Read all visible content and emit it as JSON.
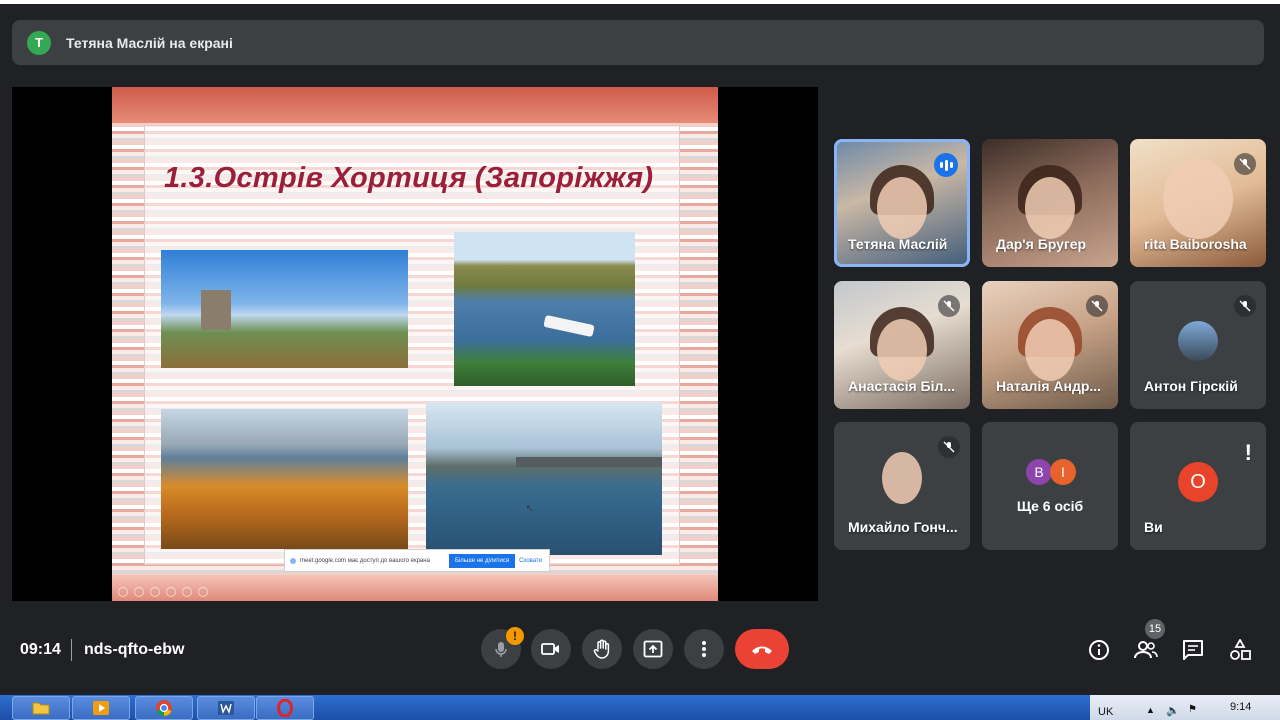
{
  "banner": {
    "avatar_letter": "T",
    "text": "Тетяна Маслій на екрані"
  },
  "presentation": {
    "title": "1.3.Острів Хортиця (Запоріжжя)",
    "share_notice": {
      "text": "meet.google.com має доступ до вашого екрана",
      "stop_label": "Більше не ділитися",
      "hide_label": "Сховати"
    }
  },
  "participants": [
    {
      "name": "Тетяна Маслій",
      "state": "speaking"
    },
    {
      "name": "Дар'я Бругер",
      "state": "video"
    },
    {
      "name": "rita Baiborosha",
      "state": "muted"
    },
    {
      "name": "Анастасія Біл...",
      "state": "muted"
    },
    {
      "name": "Наталія Андр...",
      "state": "muted"
    },
    {
      "name": "Антон Гірскій",
      "state": "muted"
    },
    {
      "name": "Михайло Гонч...",
      "state": "muted"
    },
    {
      "more_letters": [
        "В",
        "І"
      ],
      "label": "Ще 6 осіб"
    },
    {
      "name": "Ви",
      "avatar_letter": "О",
      "state": "alert"
    }
  ],
  "meeting": {
    "time": "09:14",
    "code": "nds-qfto-ebw",
    "participant_count": "15"
  },
  "colors": {
    "accent": "#8ab4f8",
    "end_call": "#ea4335",
    "warning": "#f29900",
    "speaking": "#1a73e8"
  },
  "taskbar": {
    "lang": "UK",
    "time": "9:14"
  }
}
